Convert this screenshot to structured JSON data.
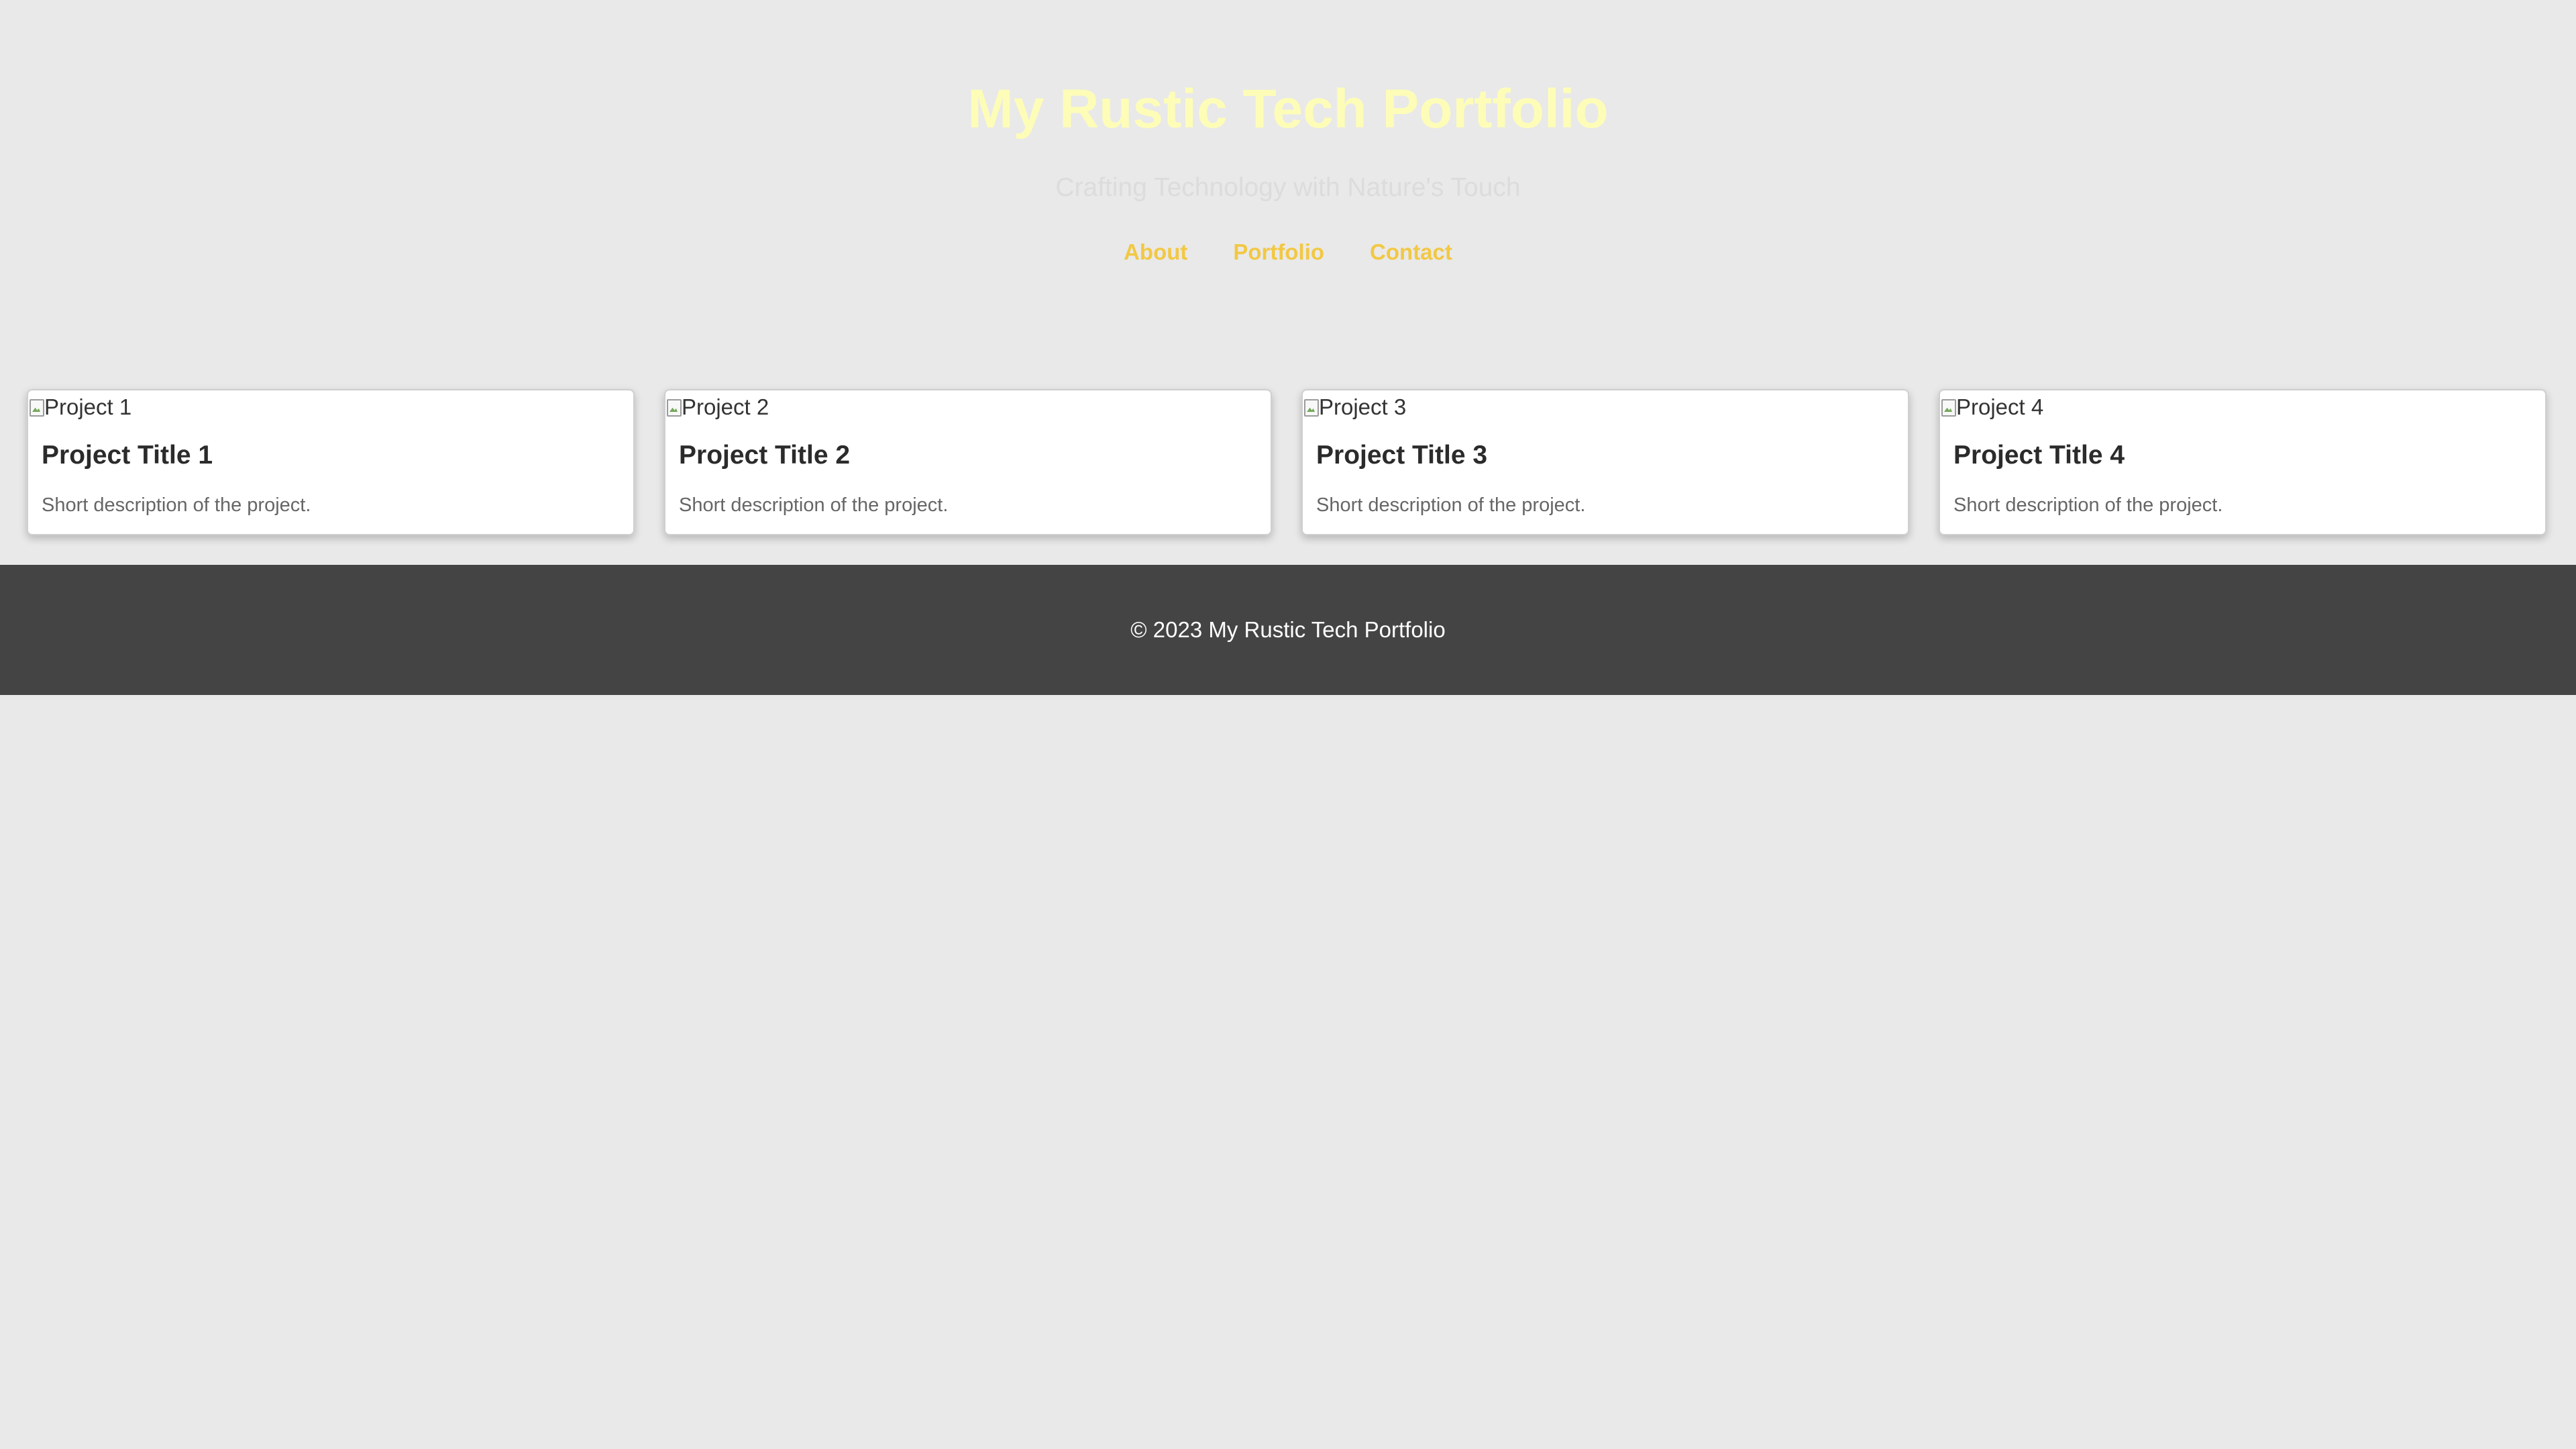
{
  "header": {
    "title": "My Rustic Tech Portfolio",
    "subtitle": "Crafting Technology with Nature's Touch",
    "nav": [
      {
        "label": "About"
      },
      {
        "label": "Portfolio"
      },
      {
        "label": "Contact"
      }
    ]
  },
  "projects": [
    {
      "image_alt": "Project 1",
      "title": "Project Title 1",
      "description": "Short description of the project."
    },
    {
      "image_alt": "Project 2",
      "title": "Project Title 2",
      "description": "Short description of the project."
    },
    {
      "image_alt": "Project 3",
      "title": "Project Title 3",
      "description": "Short description of the project."
    },
    {
      "image_alt": "Project 4",
      "title": "Project Title 4",
      "description": "Short description of the project."
    }
  ],
  "footer": {
    "copyright": "© 2023 My Rustic Tech Portfolio"
  },
  "icons": {
    "project_image_placeholder": "broken-image-icon"
  },
  "colors": {
    "background": "#e9e9e9",
    "title": "#fdfdb8",
    "nav": "#f2c844",
    "card": "#ffffff",
    "footer": "#444444"
  }
}
